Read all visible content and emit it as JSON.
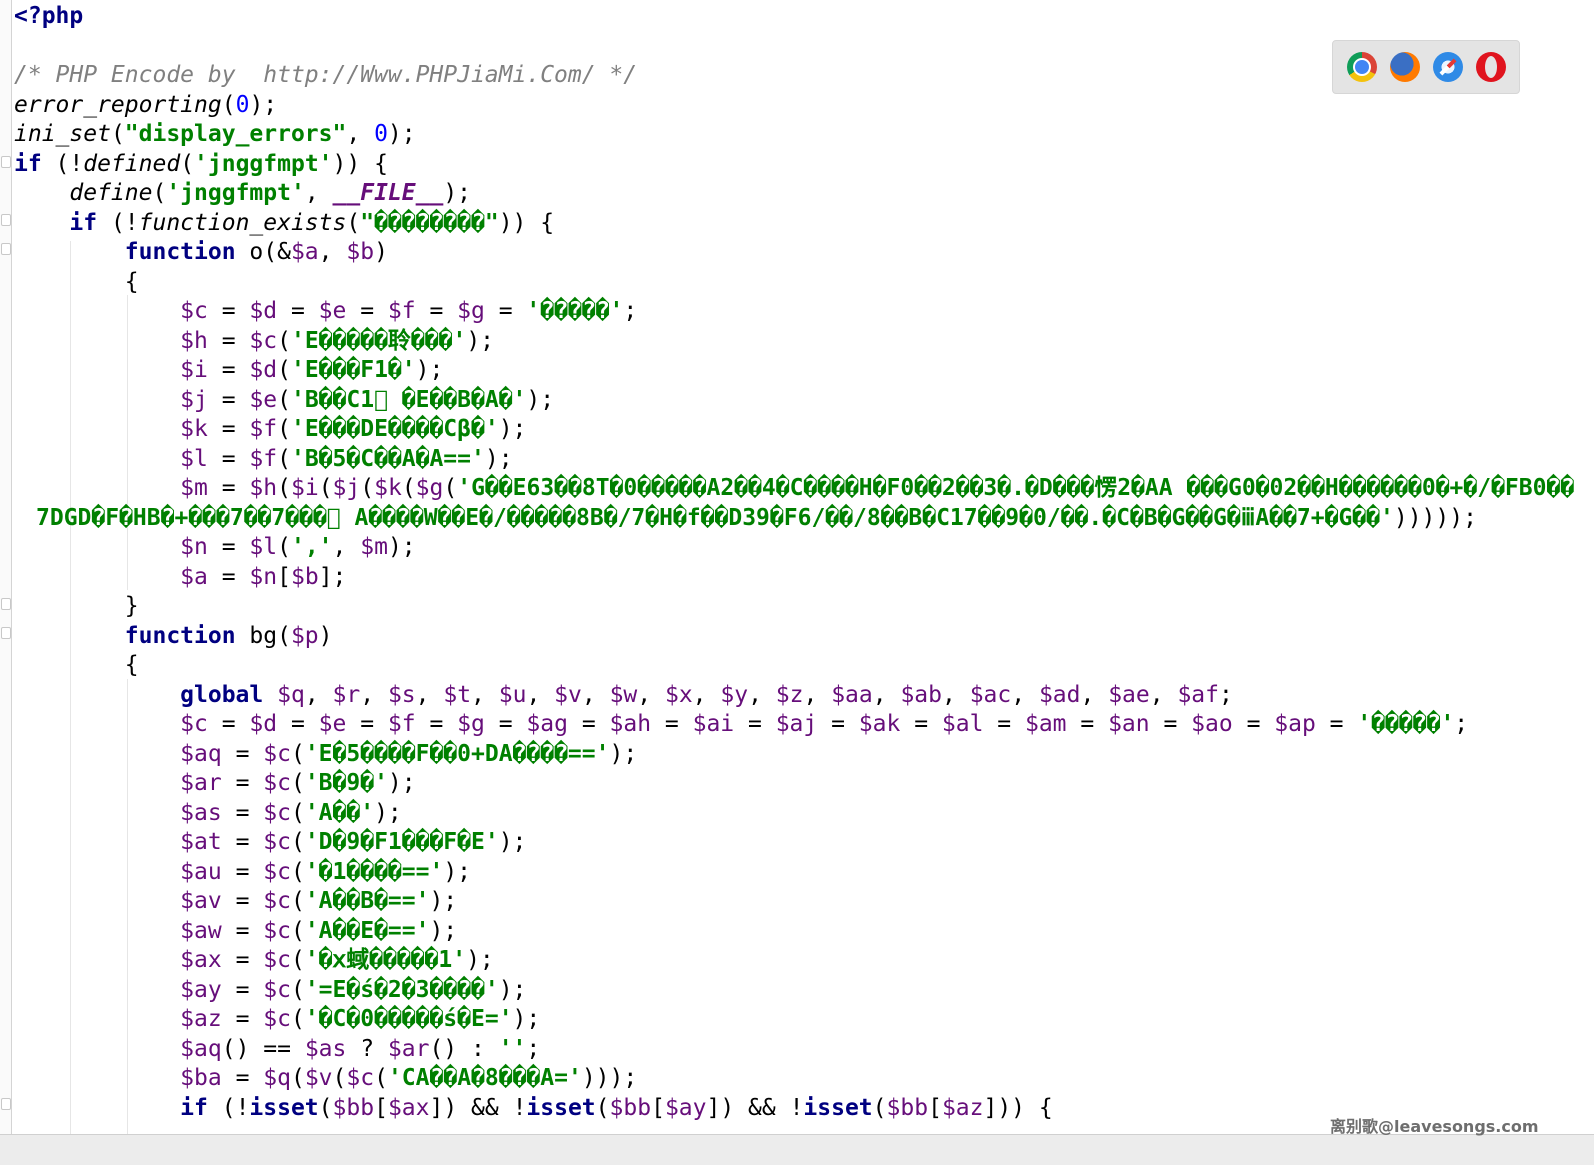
{
  "code_lines": [
    [
      {
        "t": "<?php",
        "c": "kw"
      }
    ],
    [],
    [
      {
        "t": "/* PHP Encode by  http://Www.PHPJiaMi.Com/ */",
        "c": "cmt"
      }
    ],
    [
      {
        "t": "error_reporting",
        "c": "it"
      },
      {
        "t": "("
      },
      {
        "t": "0",
        "c": "num"
      },
      {
        "t": ");"
      }
    ],
    [
      {
        "t": "ini_set",
        "c": "it"
      },
      {
        "t": "("
      },
      {
        "t": "\"display_errors\"",
        "c": "str"
      },
      {
        "t": ", "
      },
      {
        "t": "0",
        "c": "num"
      },
      {
        "t": ");"
      }
    ],
    [
      {
        "t": "if",
        "c": "kw"
      },
      {
        "t": " (!"
      },
      {
        "t": "defined",
        "c": "it"
      },
      {
        "t": "("
      },
      {
        "t": "'jnggfmpt'",
        "c": "str"
      },
      {
        "t": ")) {"
      }
    ],
    [
      {
        "t": "    "
      },
      {
        "t": "define",
        "c": "it"
      },
      {
        "t": "("
      },
      {
        "t": "'jnggfmpt'",
        "c": "str"
      },
      {
        "t": ", "
      },
      {
        "t": "__FILE__",
        "c": "mc"
      },
      {
        "t": ");"
      }
    ],
    [
      {
        "t": "    "
      },
      {
        "t": "if",
        "c": "kw"
      },
      {
        "t": " (!"
      },
      {
        "t": "function_exists",
        "c": "it"
      },
      {
        "t": "("
      },
      {
        "t": "\"��������\"",
        "c": "str"
      },
      {
        "t": ")) {"
      }
    ],
    [
      {
        "t": "        "
      },
      {
        "t": "function",
        "c": "kw"
      },
      {
        "t": " o(&"
      },
      {
        "t": "$a",
        "c": "var"
      },
      {
        "t": ", "
      },
      {
        "t": "$b",
        "c": "var"
      },
      {
        "t": ")"
      }
    ],
    [
      {
        "t": "        {"
      }
    ],
    [
      {
        "t": "            "
      },
      {
        "t": "$c",
        "c": "var"
      },
      {
        "t": " = "
      },
      {
        "t": "$d",
        "c": "var"
      },
      {
        "t": " = "
      },
      {
        "t": "$e",
        "c": "var"
      },
      {
        "t": " = "
      },
      {
        "t": "$f",
        "c": "var"
      },
      {
        "t": " = "
      },
      {
        "t": "$g",
        "c": "var"
      },
      {
        "t": " = "
      },
      {
        "t": "'�����'",
        "c": "str"
      },
      {
        "t": ";"
      }
    ],
    [
      {
        "t": "            "
      },
      {
        "t": "$h",
        "c": "var"
      },
      {
        "t": " = "
      },
      {
        "t": "$c",
        "c": "var"
      },
      {
        "t": "("
      },
      {
        "t": "'E�����聆���'",
        "c": "str"
      },
      {
        "t": ");"
      }
    ],
    [
      {
        "t": "            "
      },
      {
        "t": "$i",
        "c": "var"
      },
      {
        "t": " = "
      },
      {
        "t": "$d",
        "c": "var"
      },
      {
        "t": "("
      },
      {
        "t": "'E���F1�'",
        "c": "str"
      },
      {
        "t": ");"
      }
    ],
    [
      {
        "t": "            "
      },
      {
        "t": "$j",
        "c": "var"
      },
      {
        "t": " = "
      },
      {
        "t": "$e",
        "c": "var"
      },
      {
        "t": "("
      },
      {
        "t": "'B��C1\u0000 �E��B�A�'",
        "c": "str"
      },
      {
        "t": ");"
      }
    ],
    [
      {
        "t": "            "
      },
      {
        "t": "$k",
        "c": "var"
      },
      {
        "t": " = "
      },
      {
        "t": "$f",
        "c": "var"
      },
      {
        "t": "("
      },
      {
        "t": "'E���DE����Cβ�'",
        "c": "str"
      },
      {
        "t": ");"
      }
    ],
    [
      {
        "t": "            "
      },
      {
        "t": "$l",
        "c": "var"
      },
      {
        "t": " = "
      },
      {
        "t": "$f",
        "c": "var"
      },
      {
        "t": "("
      },
      {
        "t": "'B�5�C��A�A=='",
        "c": "str"
      },
      {
        "t": ");"
      }
    ],
    [
      {
        "t": "            "
      },
      {
        "t": "$m",
        "c": "var"
      },
      {
        "t": " = "
      },
      {
        "t": "$h",
        "c": "var"
      },
      {
        "t": "("
      },
      {
        "t": "$i",
        "c": "var"
      },
      {
        "t": "("
      },
      {
        "t": "$j",
        "c": "var"
      },
      {
        "t": "("
      },
      {
        "t": "$k",
        "c": "var"
      },
      {
        "t": "("
      },
      {
        "t": "$g",
        "c": "var"
      },
      {
        "t": "("
      },
      {
        "t": "'G��E63��8T�0�����A2��4�C����H�F0��2��3�.�D���愣2�AA ���G0�02��H������0�+�/�FB0��",
        "c": "str"
      }
    ],
    [
      {
        "t": "7DGD�F�HB�+���7��7���\u0000 A����W��E�/�����8B�/7�H�f��D39�F6/��/8��B�C17��9�0/��.�C�B�G��G�ⅲA��7+�G��'",
        "c": "str"
      },
      {
        "t": ")))));"
      }
    ],
    [
      {
        "t": "            "
      },
      {
        "t": "$n",
        "c": "var"
      },
      {
        "t": " = "
      },
      {
        "t": "$l",
        "c": "var"
      },
      {
        "t": "("
      },
      {
        "t": "','",
        "c": "str"
      },
      {
        "t": ", "
      },
      {
        "t": "$m",
        "c": "var"
      },
      {
        "t": ");"
      }
    ],
    [
      {
        "t": "            "
      },
      {
        "t": "$a",
        "c": "var"
      },
      {
        "t": " = "
      },
      {
        "t": "$n",
        "c": "var"
      },
      {
        "t": "["
      },
      {
        "t": "$b",
        "c": "var"
      },
      {
        "t": "];"
      }
    ],
    [
      {
        "t": "        }"
      }
    ],
    [
      {
        "t": "        "
      },
      {
        "t": "function",
        "c": "kw"
      },
      {
        "t": " bg("
      },
      {
        "t": "$p",
        "c": "var"
      },
      {
        "t": ")"
      }
    ],
    [
      {
        "t": "        {"
      }
    ],
    [
      {
        "t": "            "
      },
      {
        "t": "global",
        "c": "kw"
      },
      {
        "t": " "
      },
      {
        "t": "$q",
        "c": "var"
      },
      {
        "t": ", "
      },
      {
        "t": "$r",
        "c": "var"
      },
      {
        "t": ", "
      },
      {
        "t": "$s",
        "c": "var"
      },
      {
        "t": ", "
      },
      {
        "t": "$t",
        "c": "var"
      },
      {
        "t": ", "
      },
      {
        "t": "$u",
        "c": "var"
      },
      {
        "t": ", "
      },
      {
        "t": "$v",
        "c": "var"
      },
      {
        "t": ", "
      },
      {
        "t": "$w",
        "c": "var"
      },
      {
        "t": ", "
      },
      {
        "t": "$x",
        "c": "var"
      },
      {
        "t": ", "
      },
      {
        "t": "$y",
        "c": "var"
      },
      {
        "t": ", "
      },
      {
        "t": "$z",
        "c": "var"
      },
      {
        "t": ", "
      },
      {
        "t": "$aa",
        "c": "var"
      },
      {
        "t": ", "
      },
      {
        "t": "$ab",
        "c": "var"
      },
      {
        "t": ", "
      },
      {
        "t": "$ac",
        "c": "var"
      },
      {
        "t": ", "
      },
      {
        "t": "$ad",
        "c": "var"
      },
      {
        "t": ", "
      },
      {
        "t": "$ae",
        "c": "var"
      },
      {
        "t": ", "
      },
      {
        "t": "$af",
        "c": "var"
      },
      {
        "t": ";"
      }
    ],
    [
      {
        "t": "            "
      },
      {
        "t": "$c",
        "c": "var"
      },
      {
        "t": " = "
      },
      {
        "t": "$d",
        "c": "var"
      },
      {
        "t": " = "
      },
      {
        "t": "$e",
        "c": "var"
      },
      {
        "t": " = "
      },
      {
        "t": "$f",
        "c": "var"
      },
      {
        "t": " = "
      },
      {
        "t": "$g",
        "c": "var"
      },
      {
        "t": " = "
      },
      {
        "t": "$ag",
        "c": "var"
      },
      {
        "t": " = "
      },
      {
        "t": "$ah",
        "c": "var"
      },
      {
        "t": " = "
      },
      {
        "t": "$ai",
        "c": "var"
      },
      {
        "t": " = "
      },
      {
        "t": "$aj",
        "c": "var"
      },
      {
        "t": " = "
      },
      {
        "t": "$ak",
        "c": "var"
      },
      {
        "t": " = "
      },
      {
        "t": "$al",
        "c": "var"
      },
      {
        "t": " = "
      },
      {
        "t": "$am",
        "c": "var"
      },
      {
        "t": " = "
      },
      {
        "t": "$an",
        "c": "var"
      },
      {
        "t": " = "
      },
      {
        "t": "$ao",
        "c": "var"
      },
      {
        "t": " = "
      },
      {
        "t": "$ap",
        "c": "var"
      },
      {
        "t": " = "
      },
      {
        "t": "'�����'",
        "c": "str"
      },
      {
        "t": ";"
      }
    ],
    [
      {
        "t": "            "
      },
      {
        "t": "$aq",
        "c": "var"
      },
      {
        "t": " = "
      },
      {
        "t": "$c",
        "c": "var"
      },
      {
        "t": "("
      },
      {
        "t": "'E�5����F��0+DA����=='",
        "c": "str"
      },
      {
        "t": ");"
      }
    ],
    [
      {
        "t": "            "
      },
      {
        "t": "$ar",
        "c": "var"
      },
      {
        "t": " = "
      },
      {
        "t": "$c",
        "c": "var"
      },
      {
        "t": "("
      },
      {
        "t": "'B�9�'",
        "c": "str"
      },
      {
        "t": ");"
      }
    ],
    [
      {
        "t": "            "
      },
      {
        "t": "$as",
        "c": "var"
      },
      {
        "t": " = "
      },
      {
        "t": "$c",
        "c": "var"
      },
      {
        "t": "("
      },
      {
        "t": "'A��'",
        "c": "str"
      },
      {
        "t": ");"
      }
    ],
    [
      {
        "t": "            "
      },
      {
        "t": "$at",
        "c": "var"
      },
      {
        "t": " = "
      },
      {
        "t": "$c",
        "c": "var"
      },
      {
        "t": "("
      },
      {
        "t": "'D�9�F1���F�E'",
        "c": "str"
      },
      {
        "t": ");"
      }
    ],
    [
      {
        "t": "            "
      },
      {
        "t": "$au",
        "c": "var"
      },
      {
        "t": " = "
      },
      {
        "t": "$c",
        "c": "var"
      },
      {
        "t": "("
      },
      {
        "t": "'�1����=='",
        "c": "str"
      },
      {
        "t": ");"
      }
    ],
    [
      {
        "t": "            "
      },
      {
        "t": "$av",
        "c": "var"
      },
      {
        "t": " = "
      },
      {
        "t": "$c",
        "c": "var"
      },
      {
        "t": "("
      },
      {
        "t": "'A��B�=='",
        "c": "str"
      },
      {
        "t": ");"
      }
    ],
    [
      {
        "t": "            "
      },
      {
        "t": "$aw",
        "c": "var"
      },
      {
        "t": " = "
      },
      {
        "t": "$c",
        "c": "var"
      },
      {
        "t": "("
      },
      {
        "t": "'A��E�=='",
        "c": "str"
      },
      {
        "t": ");"
      }
    ],
    [
      {
        "t": "            "
      },
      {
        "t": "$ax",
        "c": "var"
      },
      {
        "t": " = "
      },
      {
        "t": "$c",
        "c": "var"
      },
      {
        "t": "("
      },
      {
        "t": "'�ⅹ蜮�����1'",
        "c": "str"
      },
      {
        "t": ");"
      }
    ],
    [
      {
        "t": "            "
      },
      {
        "t": "$ay",
        "c": "var"
      },
      {
        "t": " = "
      },
      {
        "t": "$c",
        "c": "var"
      },
      {
        "t": "("
      },
      {
        "t": "'=E�ś�2�3����'",
        "c": "str"
      },
      {
        "t": ");"
      }
    ],
    [
      {
        "t": "            "
      },
      {
        "t": "$az",
        "c": "var"
      },
      {
        "t": " = "
      },
      {
        "t": "$c",
        "c": "var"
      },
      {
        "t": "("
      },
      {
        "t": "'�C�0�����ś�E='",
        "c": "str"
      },
      {
        "t": ");"
      }
    ],
    [
      {
        "t": "            "
      },
      {
        "t": "$aq",
        "c": "var"
      },
      {
        "t": "() == "
      },
      {
        "t": "$as",
        "c": "var"
      },
      {
        "t": " ? "
      },
      {
        "t": "$ar",
        "c": "var"
      },
      {
        "t": "() : "
      },
      {
        "t": "''",
        "c": "str"
      },
      {
        "t": ";"
      }
    ],
    [
      {
        "t": "            "
      },
      {
        "t": "$ba",
        "c": "var"
      },
      {
        "t": " = "
      },
      {
        "t": "$q",
        "c": "var"
      },
      {
        "t": "("
      },
      {
        "t": "$v",
        "c": "var"
      },
      {
        "t": "("
      },
      {
        "t": "$c",
        "c": "var"
      },
      {
        "t": "("
      },
      {
        "t": "'CA��A�8���A='",
        "c": "str"
      },
      {
        "t": ")));"
      }
    ],
    [
      {
        "t": "            "
      },
      {
        "t": "if",
        "c": "kw"
      },
      {
        "t": " (!"
      },
      {
        "t": "isset",
        "c": "kw"
      },
      {
        "t": "("
      },
      {
        "t": "$bb",
        "c": "var"
      },
      {
        "t": "["
      },
      {
        "t": "$ax",
        "c": "var"
      },
      {
        "t": "]) && !"
      },
      {
        "t": "isset",
        "c": "kw"
      },
      {
        "t": "("
      },
      {
        "t": "$bb",
        "c": "var"
      },
      {
        "t": "["
      },
      {
        "t": "$ay",
        "c": "var"
      },
      {
        "t": "]) && !"
      },
      {
        "t": "isset",
        "c": "kw"
      },
      {
        "t": "("
      },
      {
        "t": "$bb",
        "c": "var"
      },
      {
        "t": "["
      },
      {
        "t": "$az",
        "c": "var"
      },
      {
        "t": "])) {"
      }
    ]
  ],
  "browser_icons": [
    "chrome-icon",
    "firefox-icon",
    "safari-icon",
    "opera-icon"
  ],
  "watermark": "离别歌@leavesongs.com",
  "colors": {
    "keyword": "#000080",
    "string": "#008000",
    "number": "#0000ff",
    "comment": "#808080",
    "variable": "#660e7a"
  }
}
